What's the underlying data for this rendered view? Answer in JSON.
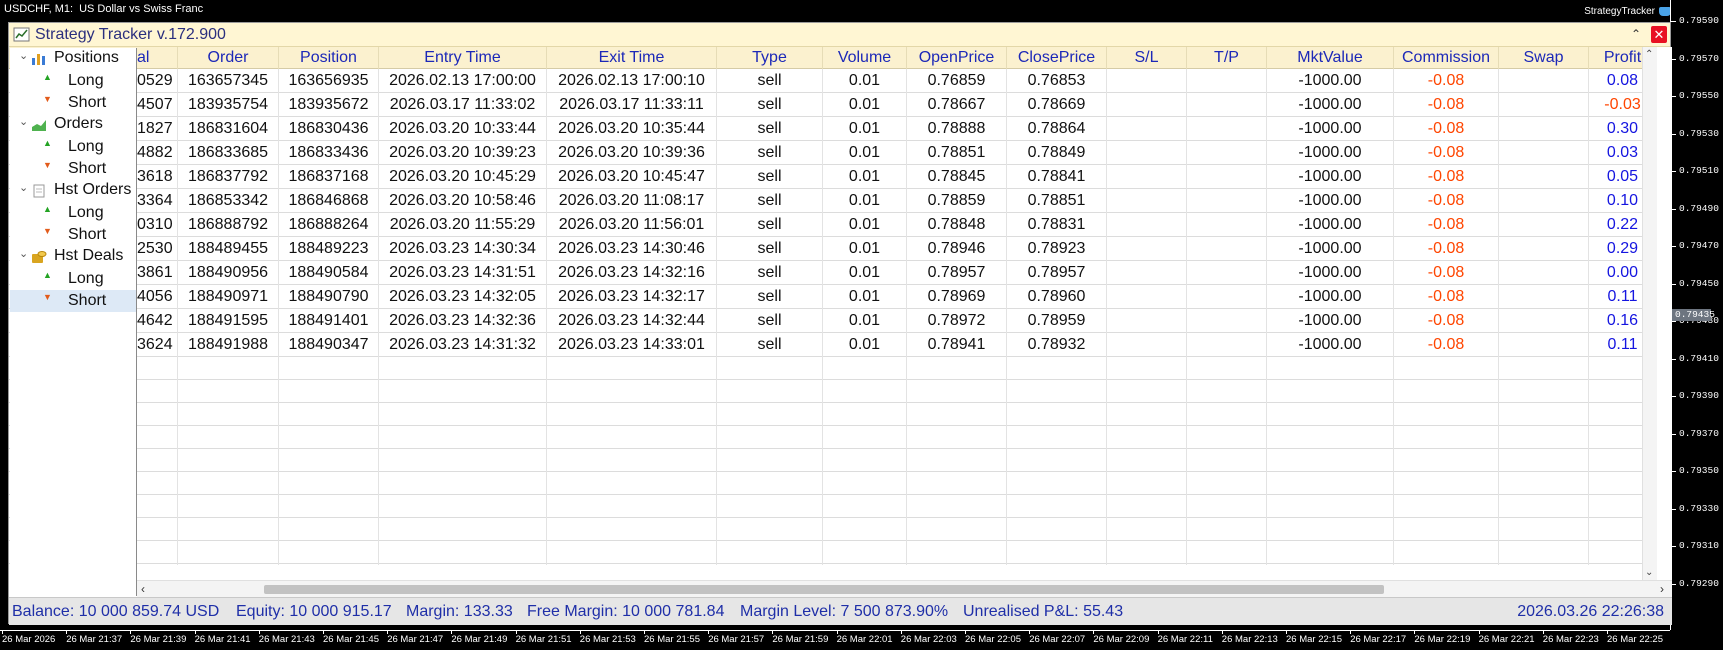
{
  "chart": {
    "symbol": "USDCHF, M1:",
    "description": "US Dollar vs Swiss Franc",
    "ea_name": "StrategyTracker",
    "price_ticks": [
      "0.79590",
      "0.79570",
      "0.79550",
      "0.79530",
      "0.79510",
      "0.79490",
      "0.79470",
      "0.79450",
      "0.79430",
      "0.79410",
      "0.79390",
      "0.79370",
      "0.79350",
      "0.79330",
      "0.79310",
      "0.79290"
    ],
    "current_price": "0.79435",
    "time_ticks": [
      "26 Mar 2026",
      "26 Mar 21:37",
      "26 Mar 21:39",
      "26 Mar 21:41",
      "26 Mar 21:43",
      "26 Mar 21:45",
      "26 Mar 21:47",
      "26 Mar 21:49",
      "26 Mar 21:51",
      "26 Mar 21:53",
      "26 Mar 21:55",
      "26 Mar 21:57",
      "26 Mar 21:59",
      "26 Mar 22:01",
      "26 Mar 22:03",
      "26 Mar 22:05",
      "26 Mar 22:07",
      "26 Mar 22:09",
      "26 Mar 22:11",
      "26 Mar 22:13",
      "26 Mar 22:15",
      "26 Mar 22:17",
      "26 Mar 22:19",
      "26 Mar 22:21",
      "26 Mar 22:23",
      "26 Mar 22:25"
    ]
  },
  "panel": {
    "title": "Strategy Tracker v.172.900",
    "up_icon": "chevron-up-icon",
    "close_icon": "close-icon",
    "tree": [
      {
        "type": "category",
        "label": "Positions",
        "icon": "bar-chart-icon"
      },
      {
        "type": "leaf",
        "label": "Long",
        "dir": "up"
      },
      {
        "type": "leaf",
        "label": "Short",
        "dir": "down"
      },
      {
        "type": "category",
        "label": "Orders",
        "icon": "area-chart-icon"
      },
      {
        "type": "leaf",
        "label": "Long",
        "dir": "up"
      },
      {
        "type": "leaf",
        "label": "Short",
        "dir": "down"
      },
      {
        "type": "category",
        "label": "Hst Orders",
        "icon": "document-icon"
      },
      {
        "type": "leaf",
        "label": "Long",
        "dir": "up"
      },
      {
        "type": "leaf",
        "label": "Short",
        "dir": "down"
      },
      {
        "type": "category",
        "label": "Hst Deals",
        "icon": "coins-icon"
      },
      {
        "type": "leaf",
        "label": "Long",
        "dir": "up"
      },
      {
        "type": "leaf",
        "label": "Short",
        "dir": "down",
        "selected": true
      }
    ],
    "columns": [
      "al",
      "Order",
      "Position",
      "Entry Time",
      "Exit Time",
      "Type",
      "Volume",
      "OpenPrice",
      "ClosePrice",
      "S/L",
      "T/P",
      "MktValue",
      "Commission",
      "Swap",
      "Profit"
    ],
    "rows": [
      [
        "0529",
        "163657345",
        "163656935",
        "2026.02.13 17:00:00",
        "2026.02.13 17:00:10",
        "sell",
        "0.01",
        "0.76859",
        "0.76853",
        "",
        "",
        "-1000.00",
        "-0.08",
        "",
        "0.08"
      ],
      [
        "4507",
        "183935754",
        "183935672",
        "2026.03.17 11:33:02",
        "2026.03.17 11:33:11",
        "sell",
        "0.01",
        "0.78667",
        "0.78669",
        "",
        "",
        "-1000.00",
        "-0.08",
        "",
        "-0.03"
      ],
      [
        "1827",
        "186831604",
        "186830436",
        "2026.03.20 10:33:44",
        "2026.03.20 10:35:44",
        "sell",
        "0.01",
        "0.78888",
        "0.78864",
        "",
        "",
        "-1000.00",
        "-0.08",
        "",
        "0.30"
      ],
      [
        "4882",
        "186833685",
        "186833436",
        "2026.03.20 10:39:23",
        "2026.03.20 10:39:36",
        "sell",
        "0.01",
        "0.78851",
        "0.78849",
        "",
        "",
        "-1000.00",
        "-0.08",
        "",
        "0.03"
      ],
      [
        "3618",
        "186837792",
        "186837168",
        "2026.03.20 10:45:29",
        "2026.03.20 10:45:47",
        "sell",
        "0.01",
        "0.78845",
        "0.78841",
        "",
        "",
        "-1000.00",
        "-0.08",
        "",
        "0.05"
      ],
      [
        "3364",
        "186853342",
        "186846868",
        "2026.03.20 10:58:46",
        "2026.03.20 11:08:17",
        "sell",
        "0.01",
        "0.78859",
        "0.78851",
        "",
        "",
        "-1000.00",
        "-0.08",
        "",
        "0.10"
      ],
      [
        "0310",
        "186888792",
        "186888264",
        "2026.03.20 11:55:29",
        "2026.03.20 11:56:01",
        "sell",
        "0.01",
        "0.78848",
        "0.78831",
        "",
        "",
        "-1000.00",
        "-0.08",
        "",
        "0.22"
      ],
      [
        "2530",
        "188489455",
        "188489223",
        "2026.03.23 14:30:34",
        "2026.03.23 14:30:46",
        "sell",
        "0.01",
        "0.78946",
        "0.78923",
        "",
        "",
        "-1000.00",
        "-0.08",
        "",
        "0.29"
      ],
      [
        "3861",
        "188490956",
        "188490584",
        "2026.03.23 14:31:51",
        "2026.03.23 14:32:16",
        "sell",
        "0.01",
        "0.78957",
        "0.78957",
        "",
        "",
        "-1000.00",
        "-0.08",
        "",
        "0.00"
      ],
      [
        "4056",
        "188490971",
        "188490790",
        "2026.03.23 14:32:05",
        "2026.03.23 14:32:17",
        "sell",
        "0.01",
        "0.78969",
        "0.78960",
        "",
        "",
        "-1000.00",
        "-0.08",
        "",
        "0.11"
      ],
      [
        "4642",
        "188491595",
        "188491401",
        "2026.03.23 14:32:36",
        "2026.03.23 14:32:44",
        "sell",
        "0.01",
        "0.78972",
        "0.78959",
        "",
        "",
        "-1000.00",
        "-0.08",
        "",
        "0.16"
      ],
      [
        "3624",
        "188491988",
        "188490347",
        "2026.03.23 14:31:32",
        "2026.03.23 14:33:01",
        "sell",
        "0.01",
        "0.78941",
        "0.78932",
        "",
        "",
        "-1000.00",
        "-0.08",
        "",
        "0.11"
      ]
    ],
    "status": {
      "balance": "Balance: 10 000 859.74 USD",
      "equity": "Equity: 10 000 915.17",
      "margin": "Margin: 133.33",
      "free_margin": "Free Margin: 10 000 781.84",
      "margin_level": "Margin Level: 7 500 873.90%",
      "unrealised": "Unrealised P&L: 55.43",
      "datetime": "2026.03.26 22:26:38"
    }
  },
  "colors": {
    "negative": "#ff4500",
    "positive": "#1515e0",
    "header_text": "#1c28b8",
    "header_bg": "#fbf1cf"
  }
}
